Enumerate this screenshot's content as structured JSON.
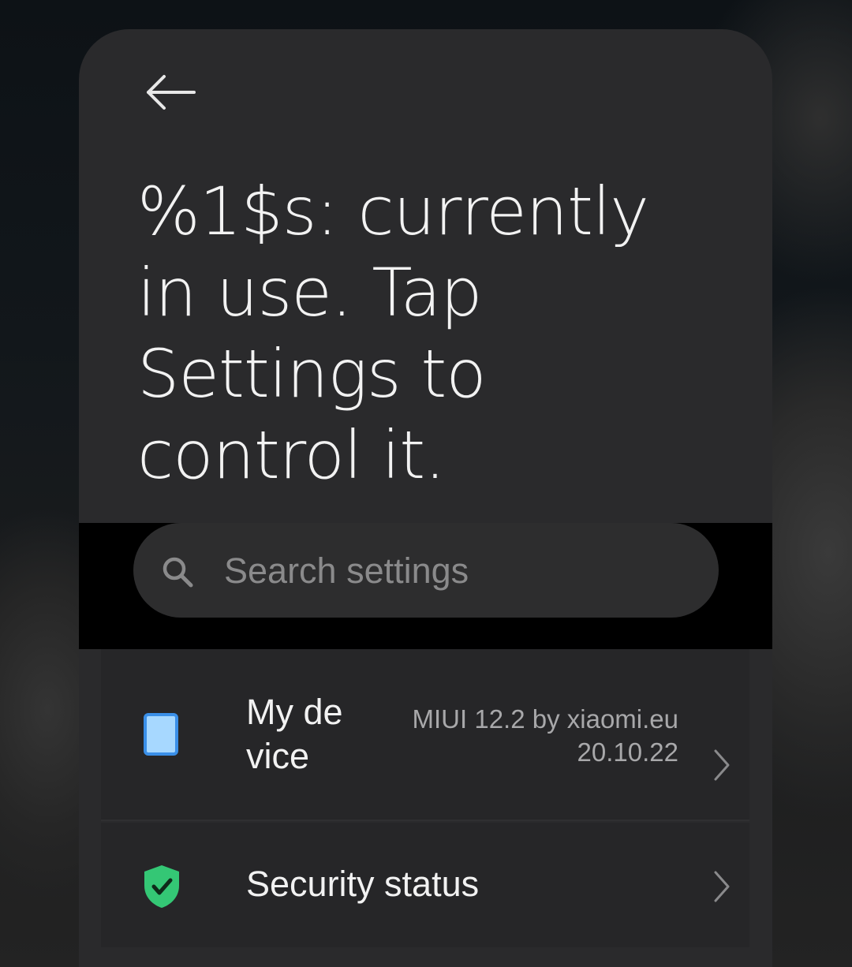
{
  "header": {
    "back_icon": "arrow-left-icon",
    "headline_lines": [
      "%1$s: currently",
      "in use. Tap",
      "Settings to",
      "control it."
    ]
  },
  "search": {
    "icon": "search-icon",
    "placeholder": "Search settings"
  },
  "settings_list": [
    {
      "icon": "phone-device-icon",
      "title_lines": [
        "My de",
        "vice"
      ],
      "value_lines": [
        "MIUI 12.2 by xiaomi.eu",
        "20.10.22"
      ],
      "chevron": "chevron-right-icon"
    },
    {
      "icon": "shield-check-icon",
      "title": "Security status",
      "chevron": "chevron-right-icon"
    }
  ],
  "colors": {
    "panel": "#2a2a2c",
    "search_band": "#000000",
    "device_icon": "#a7d8ff",
    "device_icon_border": "#3a8fe8",
    "security_icon": "#34c775",
    "text_primary": "#f2f2f2",
    "text_secondary": "#a8a8aa"
  }
}
